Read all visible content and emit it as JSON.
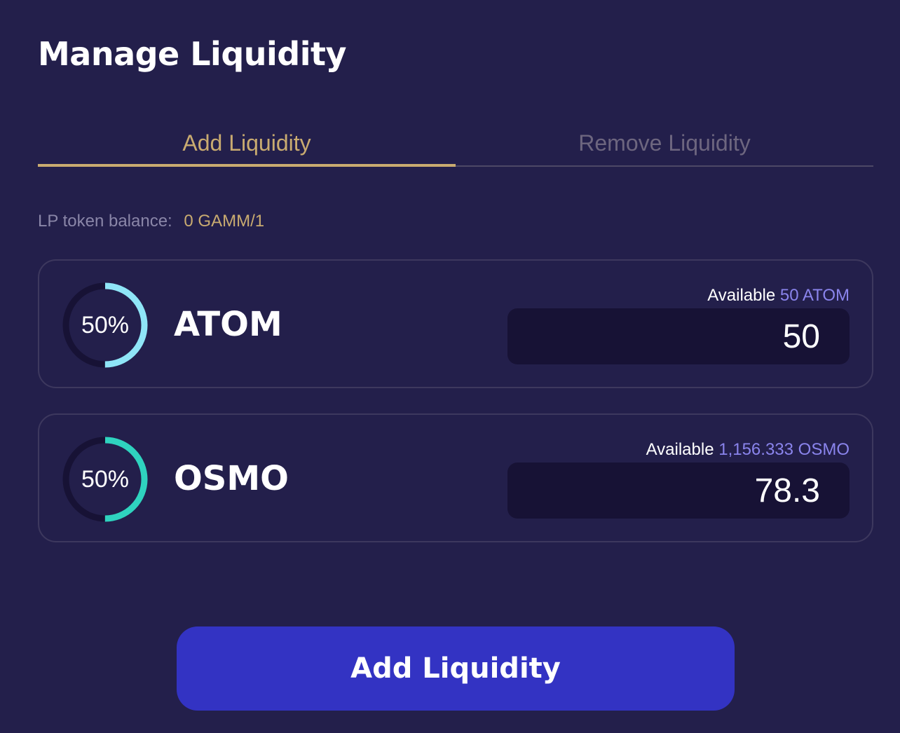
{
  "page": {
    "title": "Manage Liquidity"
  },
  "tabs": [
    {
      "label": "Add Liquidity",
      "active": true
    },
    {
      "label": "Remove Liquidity",
      "active": false
    }
  ],
  "lp_balance": {
    "label": "LP token balance:",
    "value": "0 GAMM/1"
  },
  "assets": [
    {
      "symbol": "ATOM",
      "weight_label": "50%",
      "weight": 0.5,
      "ring_color": "#8fe5f7",
      "available_label": "Available",
      "available_value": "50 ATOM",
      "input_value": "50"
    },
    {
      "symbol": "OSMO",
      "weight_label": "50%",
      "weight": 0.5,
      "ring_color": "#2fd3bf",
      "available_label": "Available",
      "available_value": "1,156.333 OSMO",
      "input_value": "78.3"
    }
  ],
  "colors": {
    "background": "#231f4b",
    "accent_gold": "#c9ab70",
    "available_amount": "#8a84ec",
    "input_background": "#171235",
    "ring_track": "#171235",
    "button": "#3333c3"
  },
  "submit": {
    "label": "Add Liquidity"
  }
}
